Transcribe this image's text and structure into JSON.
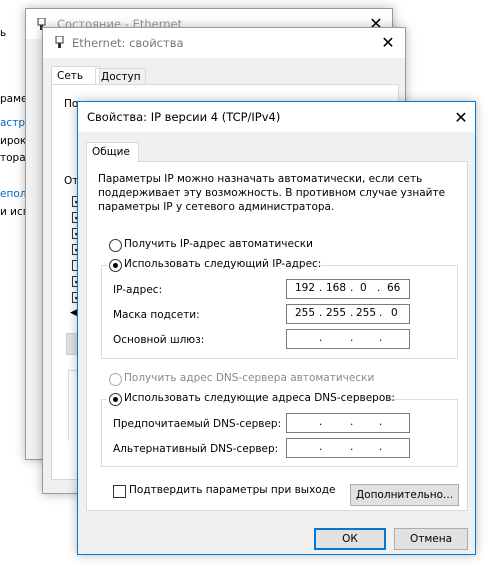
{
  "background": {
    "left_texts": [
      "ь",
      "раметр",
      "астрой",
      "ирокс",
      "тора и",
      "еполо",
      "и исп"
    ]
  },
  "window_status": {
    "title": "Состояние - Ethernet"
  },
  "window_props": {
    "title": "Ethernet: свойства",
    "tabs": [
      "Сеть",
      "Доступ"
    ],
    "partial_labels": [
      "Подкл",
      "От"
    ]
  },
  "dialog": {
    "title": "Свойства: IP версии 4 (TCP/IPv4)",
    "tab": "Общие",
    "description": "Параметры IP можно назначать автоматически, если сеть поддерживает эту возможность. В противном случае узнайте параметры IP у сетевого администратора.",
    "description_lines": [
      "Параметры IP можно назначать автоматически, если сеть",
      "поддерживает эту возможность. В противном случае узнайте",
      "параметры IP у сетевого администратора."
    ],
    "ip_auto_label": "Получить IP-адрес автоматически",
    "ip_manual_label": "Использовать следующий IP-адрес:",
    "ip_mode": "manual",
    "fields": {
      "ip_label": "IP-адрес:",
      "ip": [
        "192",
        "168",
        "0",
        "66"
      ],
      "mask_label": "Маска подсети:",
      "mask": [
        "255",
        "255",
        "255",
        "0"
      ],
      "gateway_label": "Основной шлюз:",
      "gateway": [
        "",
        "",
        "",
        ""
      ]
    },
    "dns_auto_label": "Получить адрес DNS-сервера автоматически",
    "dns_manual_label": "Использовать следующие адреса DNS-серверов:",
    "dns_mode": "manual",
    "dns": {
      "preferred_label": "Предпочитаемый DNS-сервер:",
      "preferred": [
        "",
        "",
        "",
        ""
      ],
      "alternate_label": "Альтернативный DNS-сервер:",
      "alternate": [
        "",
        "",
        "",
        ""
      ]
    },
    "validate_label": "Подтвердить параметры при выходе",
    "validate_checked": false,
    "advanced_label": "Дополнительно...",
    "ok_label": "ОК",
    "cancel_label": "Отмена"
  },
  "colors": {
    "accent": "#0078d7",
    "window_bg": "#f0f0f0",
    "titlebar": "#ffffff"
  }
}
